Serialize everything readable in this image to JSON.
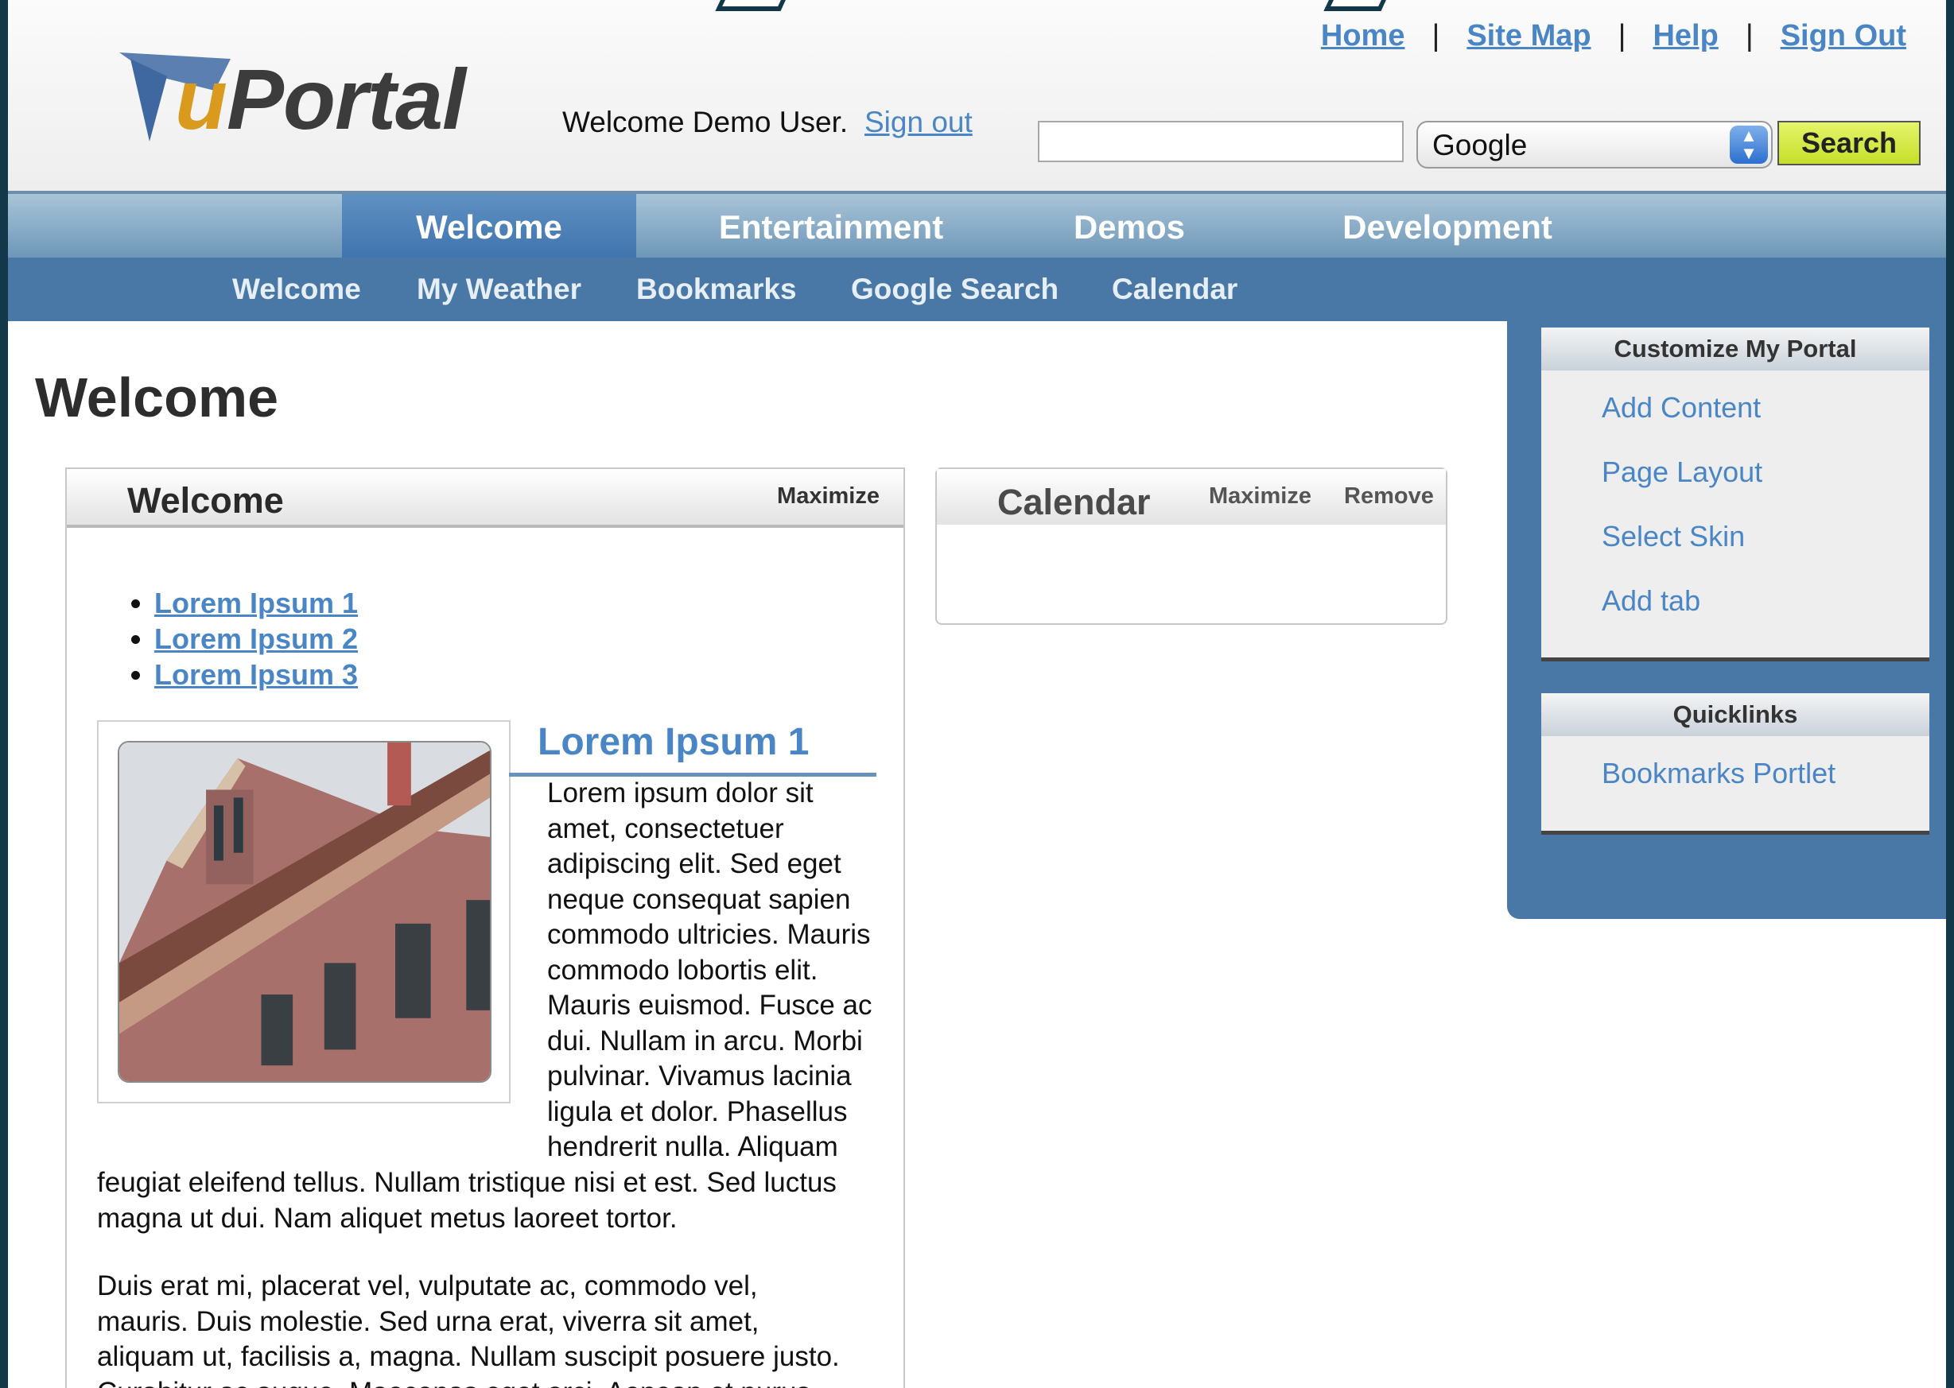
{
  "app": {
    "logo_text_u": "u",
    "logo_text_rest": "Portal"
  },
  "header": {
    "welcome_text": "Welcome Demo User.",
    "signout_label": "Sign out",
    "toplinks": [
      "Home",
      "Site Map",
      "Help",
      "Sign Out"
    ],
    "search": {
      "value": "",
      "engine": "Google",
      "button_label": "Search"
    }
  },
  "tabs": [
    {
      "label": "Welcome",
      "active": true
    },
    {
      "label": "Entertainment",
      "active": false
    },
    {
      "label": "Demos",
      "active": false
    },
    {
      "label": "Development",
      "active": false
    }
  ],
  "subnav": [
    "Welcome",
    "My Weather",
    "Bookmarks",
    "Google Search",
    "Calendar"
  ],
  "page_title": "Welcome",
  "welcome_portlet": {
    "title": "Welcome",
    "maximize_label": "Maximize",
    "links": [
      "Lorem Ipsum 1",
      "Lorem Ipsum 2",
      "Lorem Ipsum 3"
    ],
    "article_title": "Lorem Ipsum 1",
    "article_lines": [
      "Lorem ipsum dolor sit",
      "amet, consectetuer",
      "adipiscing elit. Sed eget",
      "neque consequat sapien",
      "commodo ultricies. Mauris",
      "commodo lobortis elit.",
      "Mauris euismod. Fusce ac",
      "dui. Nullam in arcu. Morbi",
      "pulvinar. Vivamus lacinia",
      "ligula et dolor. Phasellus",
      "hendrerit nulla. Aliquam"
    ],
    "article_tail": [
      "feugiat eleifend tellus. Nullam tristique nisi et est. Sed luctus",
      "magna ut dui. Nam aliquet metus laoreet tortor."
    ],
    "paragraph2": [
      "Duis erat mi, placerat vel, vulputate ac, commodo vel,",
      "mauris. Duis molestie. Sed urna erat, viverra sit amet,",
      "aliquam ut, facilisis a, magna. Nullam suscipit posuere justo.",
      "Curabitur ac augue. Maecenas eget orci. Aenean et purus"
    ]
  },
  "calendar_portlet": {
    "title": "Calendar",
    "maximize_label": "Maximize",
    "remove_label": "Remove"
  },
  "sidebar": {
    "customize": {
      "title": "Customize My Portal",
      "links": [
        "Add Content",
        "Page Layout",
        "Select Skin",
        "Add tab"
      ]
    },
    "quicklinks": {
      "title": "Quicklinks",
      "links": [
        "Bookmarks Portlet"
      ]
    }
  },
  "colors": {
    "link": "#4a86c5",
    "nav_blue": "#4a78a6",
    "search_button": "#d4eb3c",
    "logo_accent": "#d99a1e"
  }
}
